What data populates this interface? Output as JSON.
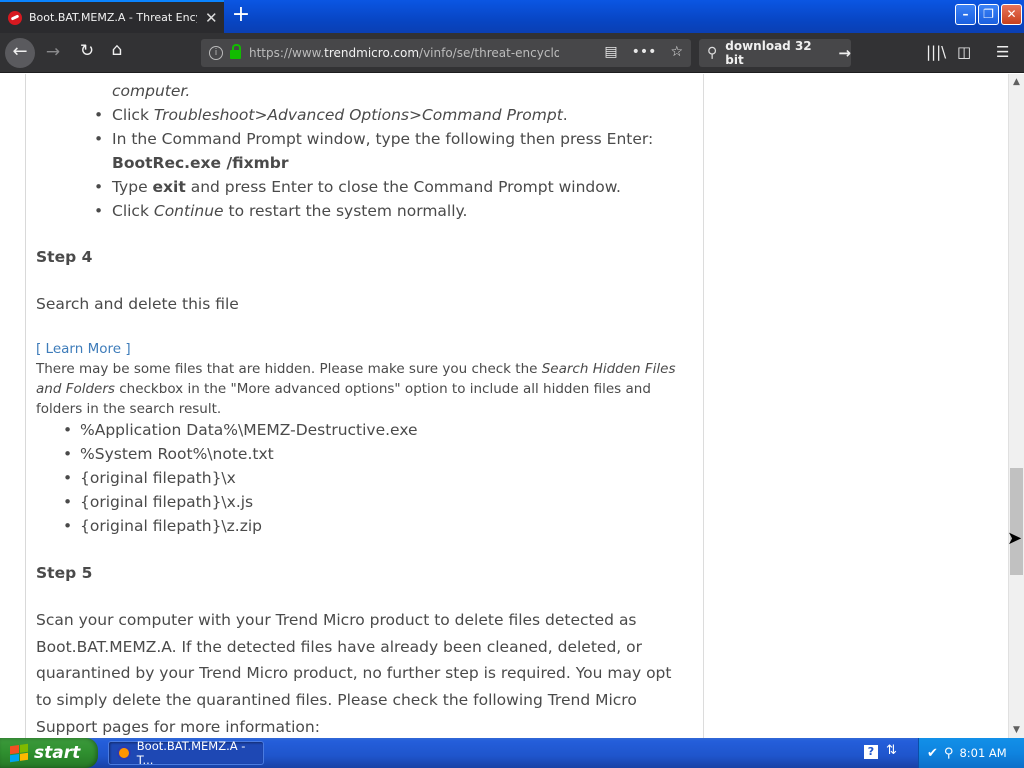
{
  "browser": {
    "tab_title": "Boot.BAT.MEMZ.A - Threat Encyclo",
    "tab_close": "✕",
    "new_tab": "+",
    "url_prefix": "https://www.",
    "url_domain": "trendmicro.com",
    "url_rest": "/vinfo/se/threat-encyclop",
    "search_text": "download 32 bit"
  },
  "content": {
    "partial_top": "computer.",
    "steps_top": [
      {
        "prefix": "Click ",
        "em": "Troubleshoot>Advanced Options>Command Prompt",
        "suffix": "."
      },
      {
        "text": "In the Command Prompt window, type the following then press Enter:",
        "bold_line": "BootRec.exe /fixmbr"
      },
      {
        "prefix": "Type ",
        "bold": "exit",
        "suffix": " and press Enter to close the Command Prompt window."
      },
      {
        "prefix": "Click ",
        "em": "Continue",
        "suffix": " to restart the system normally."
      }
    ],
    "step4_title": "Step 4",
    "step4_text": "Search and delete this file",
    "learn_more": "[ Learn More ]",
    "note_prefix": "There may be some files that are hidden. Please make sure you check the ",
    "note_em": "Search Hidden Files and Folders",
    "note_suffix": " checkbox in the \"More advanced options\" option to include all hidden files and folders in the search result.",
    "files": [
      "%Application Data%\\MEMZ-Destructive.exe",
      "%System Root%\\note.txt",
      "{original filepath}\\x",
      "{original filepath}\\x.js",
      "{original filepath}\\z.zip"
    ],
    "step5_title": "Step 5",
    "step5_text": "Scan your computer with your Trend Micro product to delete files detected as Boot.BAT.MEMZ.A. If the detected files have already been cleaned, deleted, or quarantined by your Trend Micro product, no further step is required. You may opt to simply delete the quarantined files. Please check the following Trend Micro Support pages for more information:"
  },
  "scroll": {
    "position": 0.72,
    "visible_fraction": 0.17
  },
  "taskbar": {
    "start_label": "start",
    "task_label": "Boot.BAT.MEMZ.A - T...",
    "clock": "8:01 AM",
    "help": "?"
  },
  "colors": {
    "link": "#3e7cba",
    "text": "#4a4a4a",
    "ff_chrome": "#323234",
    "xp_blue": "#245edb",
    "xp_green": "#2f8f2f"
  }
}
